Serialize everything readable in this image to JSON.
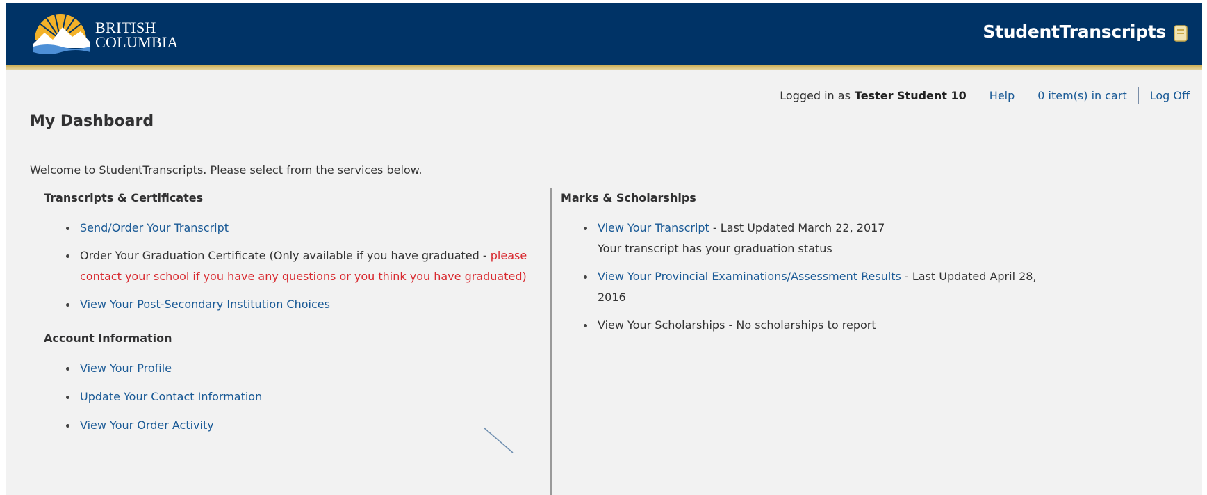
{
  "header": {
    "logo_line1": "BRITISH",
    "logo_line2": "COLUMBIA",
    "app_title": "StudentTranscripts",
    "bar_color": "#003366",
    "accent_color": "#c9a94a"
  },
  "userbar": {
    "logged_in_prefix": "Logged in as",
    "user_name": "Tester Student 10",
    "help": "Help",
    "cart": "0 item(s) in cart",
    "logoff": "Log Off"
  },
  "page": {
    "title": "My Dashboard",
    "welcome": "Welcome to StudentTranscripts. Please select from the services below."
  },
  "transcripts": {
    "heading": "Transcripts & Certificates",
    "send_order": "Send/Order Your Transcript",
    "grad_cert_line1": "Order Your Graduation Certificate (Only available if you have graduated - ",
    "grad_cert_red1": "please",
    "grad_cert_red2": "contact your school if you have any questions or you think you have graduated)",
    "post_secondary": "View Your Post-Secondary Institution Choices"
  },
  "account": {
    "heading": "Account Information",
    "profile": "View Your Profile",
    "contact": "Update Your Contact Information",
    "orders": "View Your Order Activity"
  },
  "marks": {
    "heading": "Marks & Scholarships",
    "transcript_link": "View Your Transcript",
    "transcript_updated": " - Last Updated March 22, 2017",
    "transcript_status": "Your transcript has your graduation status",
    "exams_link": "View Your Provincial Examinations/Assessment Results",
    "exams_updated_1": " - Last Updated April 28,",
    "exams_updated_2": "2016",
    "scholarships": "View Your Scholarships - No scholarships to report"
  },
  "colors": {
    "link": "#1a5a96",
    "warning_text": "#d8292f",
    "panel_bg": "#f2f2f2"
  }
}
